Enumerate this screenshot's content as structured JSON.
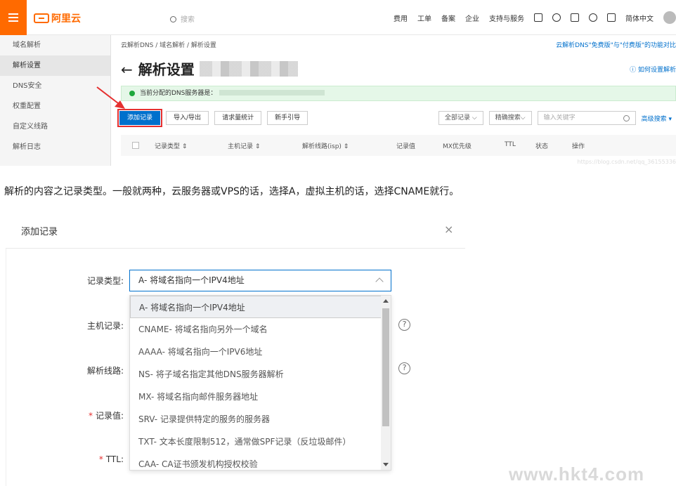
{
  "console": {
    "logo": "阿里云",
    "search_placeholder": "搜索",
    "topnav": [
      "费用",
      "工单",
      "备案",
      "企业",
      "支持与服务"
    ],
    "language": "简体中文",
    "sidebar": [
      {
        "label": "域名解析",
        "active": false
      },
      {
        "label": "解析设置",
        "active": true
      },
      {
        "label": "DNS安全",
        "active": false
      },
      {
        "label": "权重配置",
        "active": false
      },
      {
        "label": "自定义线路",
        "active": false
      },
      {
        "label": "解析日志",
        "active": false
      }
    ],
    "breadcrumb": "云解析DNS / 域名解析 / 解析设置",
    "promo": "云解析DNS\"免费版\"与\"付费版\"的功能对比",
    "page_title": "解析设置",
    "help_link": "如何设置解析",
    "notice": "当前分配的DNS服务器是：",
    "toolbar": [
      "添加记录",
      "导入/导出",
      "请求量统计",
      "新手引导"
    ],
    "filter_all": "全部记录",
    "filter_exact": "精确搜索",
    "keyword_placeholder": "输入关键字",
    "advanced": "高级搜索",
    "columns": [
      "记录类型 ⇕",
      "主机记录 ⇕",
      "解析线路(isp) ⇕",
      "记录值",
      "MX优先级",
      "TTL",
      "状态",
      "操作"
    ],
    "csdn_watermark": "https://blog.csdn.net/qq_36155336"
  },
  "article_text": "解析的内容之记录类型。一般就两种，云服务器或VPS的话，选择A，虚拟主机的话，选择CNAME就行。",
  "dialog": {
    "title": "添加记录",
    "close": "×",
    "fields": {
      "record_type": "记录类型:",
      "host": "主机记录:",
      "line": "解析线路:",
      "value": "记录值:",
      "ttl": "TTL:"
    },
    "selected": "A- 将域名指向一个IPV4地址",
    "options": [
      "A- 将域名指向一个IPV4地址",
      "CNAME- 将域名指向另外一个域名",
      "AAAA- 将域名指向一个IPV6地址",
      "NS- 将子域名指定其他DNS服务器解析",
      "MX- 将域名指向邮件服务器地址",
      "SRV- 记录提供特定的服务的服务器",
      "TXT- 文本长度限制512，通常做SPF记录（反垃圾邮件）",
      "CAA- CA证书颁发机构授权校验"
    ]
  },
  "site_watermark": "www.hkt4.com"
}
